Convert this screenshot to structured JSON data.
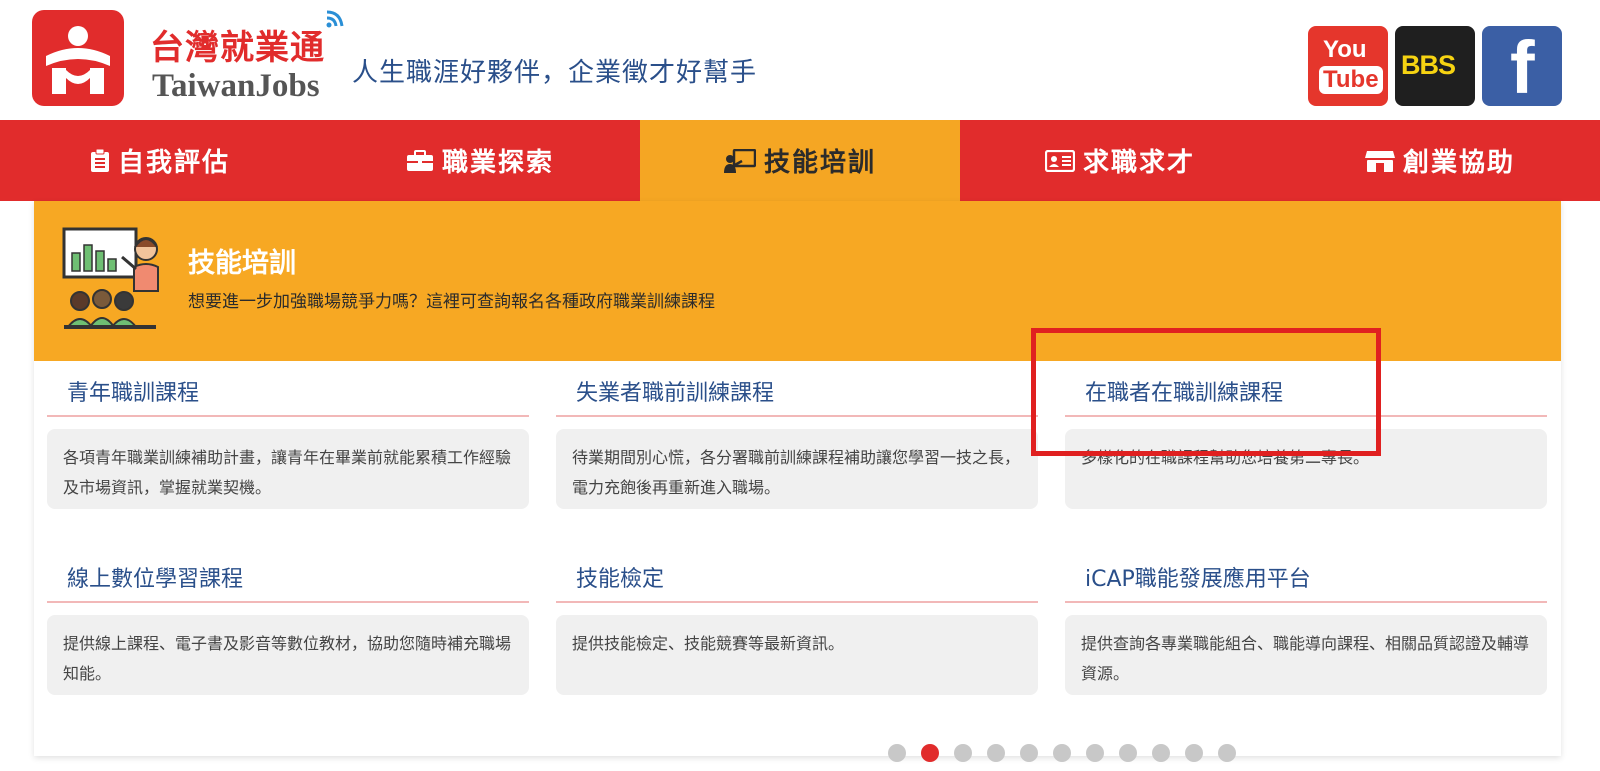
{
  "header": {
    "logo_cn": "台灣就業通",
    "logo_en": "TaiwanJobs",
    "slogan": "人生職涯好夥伴，企業徵才好幫手",
    "social": {
      "youtube_top": "You",
      "youtube_bottom": "Tube",
      "bbs": "BBS",
      "facebook": "f"
    }
  },
  "nav": {
    "items": [
      {
        "label": "自我評估",
        "icon": "clipboard-icon"
      },
      {
        "label": "職業探索",
        "icon": "briefcase-icon"
      },
      {
        "label": "技能培訓",
        "icon": "presentation-icon",
        "active": true
      },
      {
        "label": "求職求才",
        "icon": "id-card-icon"
      },
      {
        "label": "創業協助",
        "icon": "store-icon"
      }
    ]
  },
  "banner": {
    "title": "技能培訓",
    "description": "想要進一步加強職場競爭力嗎？這裡可查詢報名各種政府職業訓練課程"
  },
  "cards": [
    {
      "title": "青年職訓課程",
      "description": "各項青年職業訓練補助計畫，讓青年在畢業前就能累積工作經驗及市場資訊，掌握就業契機。"
    },
    {
      "title": "失業者職前訓練課程",
      "description": "待業期間別心慌，各分署職前訓練課程補助讓您學習一技之長，電力充飽後再重新進入職場。"
    },
    {
      "title": "在職者在職訓練課程",
      "description": "多樣化的在職課程幫助您培養第二專長。"
    },
    {
      "title": "線上數位學習課程",
      "description": "提供線上課程、電子書及影音等數位教材，協助您隨時補充職場知能。"
    },
    {
      "title": "技能檢定",
      "description": "提供技能檢定、技能競賽等最新資訊。"
    },
    {
      "title": "iCAP職能發展應用平台",
      "description": "提供查詢各專業職能組合、職能導向課程、相關品質認證及輔導資源。"
    }
  ],
  "carousel": {
    "total": 11,
    "active_index": 1
  },
  "colors": {
    "brand_red": "#e12c2c",
    "accent_orange": "#f5a623",
    "link_blue": "#2a4f8a",
    "highlight_red": "#e02020"
  }
}
